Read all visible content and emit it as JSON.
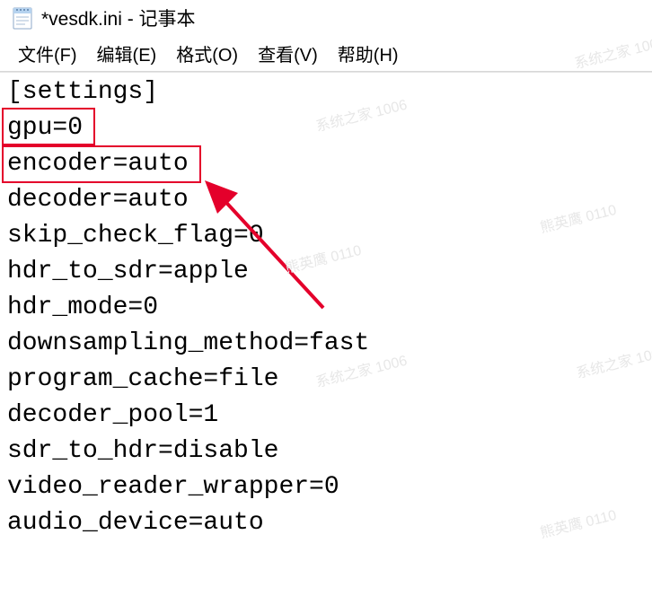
{
  "window": {
    "title": "*vesdk.ini - 记事本"
  },
  "menu": {
    "file": "文件(F)",
    "edit": "编辑(E)",
    "format": "格式(O)",
    "view": "查看(V)",
    "help": "帮助(H)"
  },
  "content": {
    "lines": [
      "[settings]",
      "gpu=0",
      "encoder=auto",
      "decoder=auto",
      "skip_check_flag=0",
      "hdr_to_sdr=apple",
      "hdr_mode=0",
      "downsampling_method=fast",
      "program_cache=file",
      "decoder_pool=1",
      "sdr_to_hdr=disable",
      "video_reader_wrapper=0",
      "audio_device=auto"
    ]
  },
  "highlight": {
    "box1_target": "gpu=0",
    "box2_target": "encoder=auto"
  },
  "annotation_color": "#e4002b",
  "watermarks": {
    "a": "系统之家 1006",
    "b": "熊英鹰 0110"
  }
}
